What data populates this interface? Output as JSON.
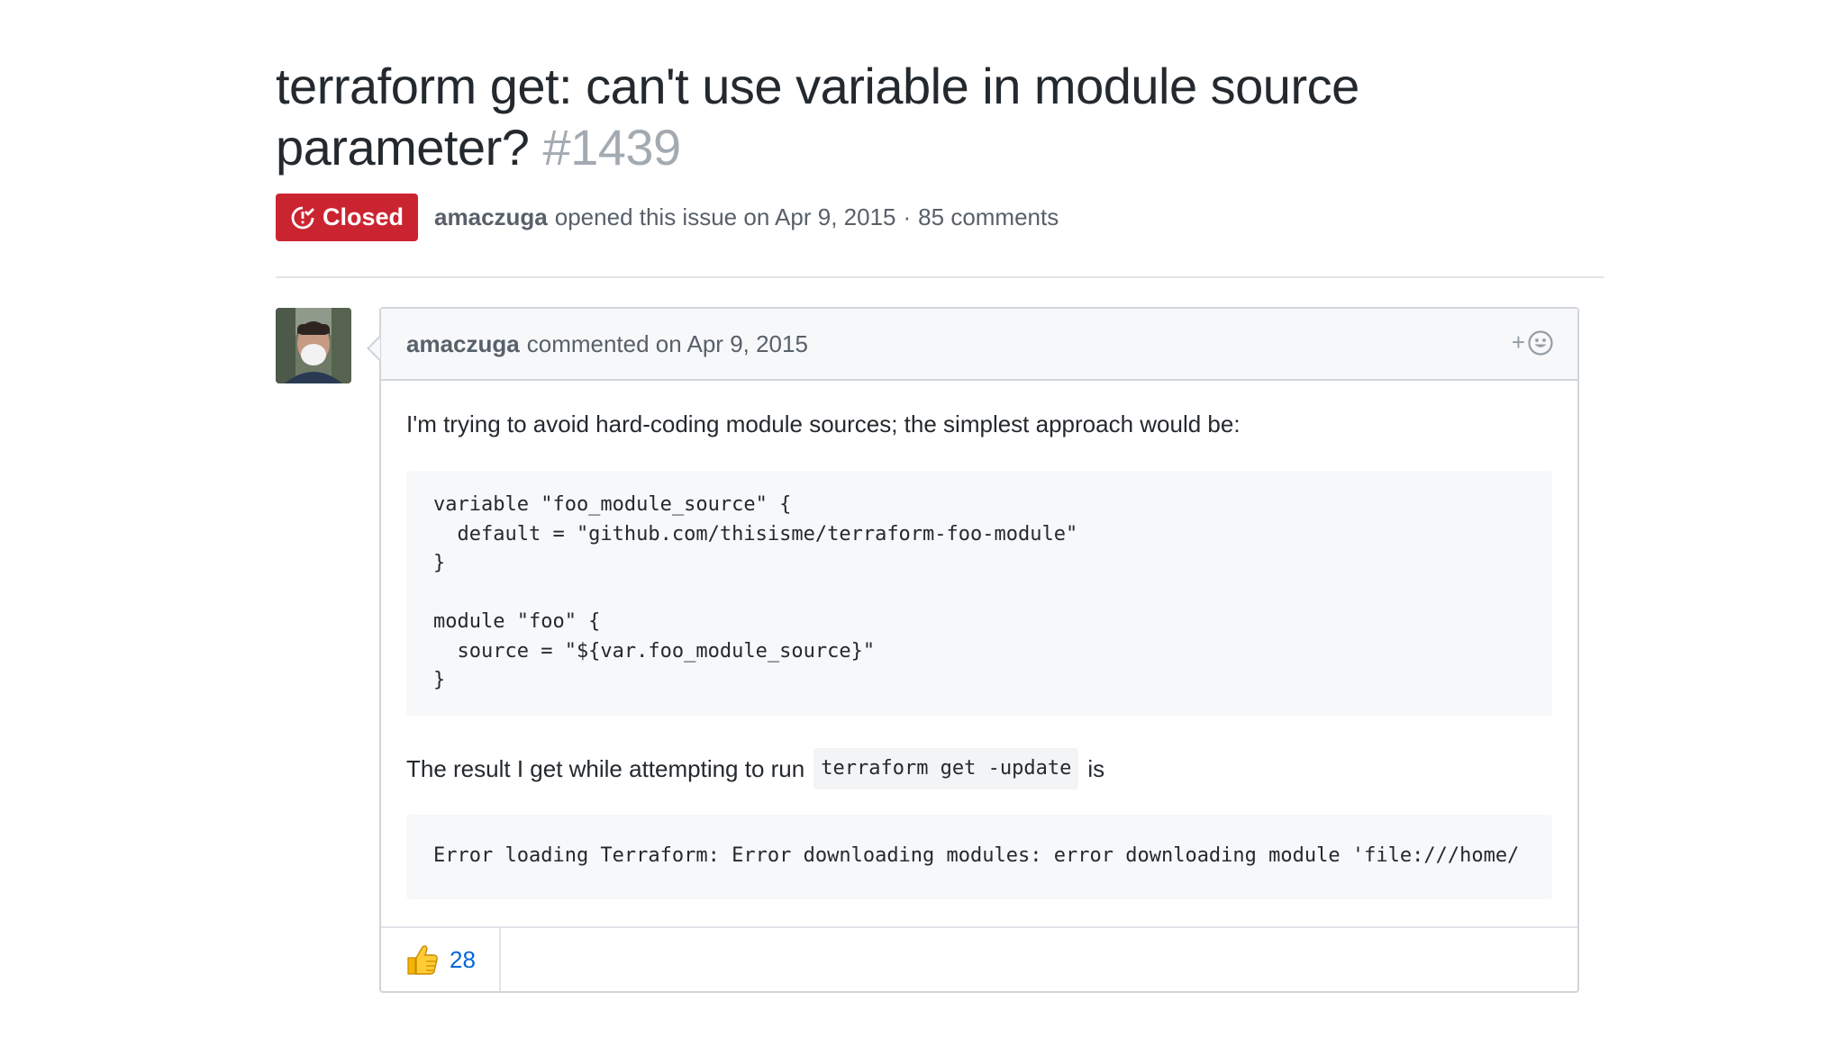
{
  "issue": {
    "title": "terraform get: can't use variable in module source parameter?",
    "number": "#1439",
    "state": "Closed",
    "state_color": "#cb2431",
    "author": "amaczuga",
    "opened_text": "opened this issue on Apr 9, 2015",
    "separator": "·",
    "comments_count": "85 comments"
  },
  "comment": {
    "author": "amaczuga",
    "timestamp_text": "commented on Apr 9, 2015",
    "add_reaction_label": "+",
    "body": {
      "intro": "I'm trying to avoid hard-coding module sources; the simplest approach would be:",
      "code_block": "variable \"foo_module_source\" {\n  default = \"github.com/thisisme/terraform-foo-module\"\n}\n\nmodule \"foo\" {\n  source = \"${var.foo_module_source}\"\n}",
      "result_prefix": "The result I get while attempting to run",
      "result_command": "terraform get -update",
      "result_suffix": "is",
      "error_block": "Error loading Terraform: Error downloading modules: error downloading module 'file:///home/"
    },
    "reactions": [
      {
        "icon": "thumbs-up-icon",
        "emoji": "👍",
        "count": "28"
      }
    ]
  },
  "colors": {
    "link": "#0366d6",
    "muted": "#586069",
    "issue_number": "#a3aab1"
  }
}
